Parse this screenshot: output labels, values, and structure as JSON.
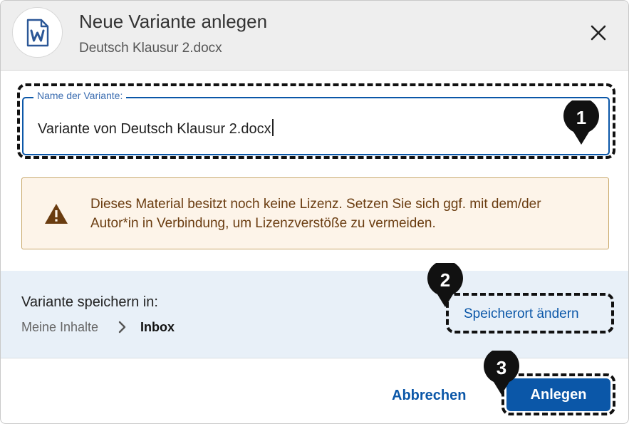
{
  "header": {
    "title": "Neue Variante anlegen",
    "subtitle": "Deutsch Klausur 2.docx",
    "file_icon": "word-document-icon",
    "close_icon": "close-icon"
  },
  "name_field": {
    "label": "Name der Variante:",
    "value": "Variante von Deutsch Klausur 2.docx"
  },
  "warning": {
    "icon": "warning-icon",
    "text": "Dieses Material besitzt noch keine Lizenz. Setzen Sie sich ggf. mit dem/der Autor*in in Verbindung, um Lizenzverstöße zu vermeiden."
  },
  "location": {
    "label": "Variante speichern in:",
    "breadcrumb": [
      "Meine Inhalte",
      "Inbox"
    ],
    "change_label": "Speicherort ändern"
  },
  "footer": {
    "cancel_label": "Abbrechen",
    "create_label": "Anlegen"
  },
  "callouts": [
    "1",
    "2",
    "3"
  ],
  "colors": {
    "accent": "#0b57a8",
    "warning_bg": "#fdf4e9",
    "warning_text": "#6a3c10",
    "band_bg": "#e8f0f8",
    "header_bg": "#eeeeee"
  }
}
